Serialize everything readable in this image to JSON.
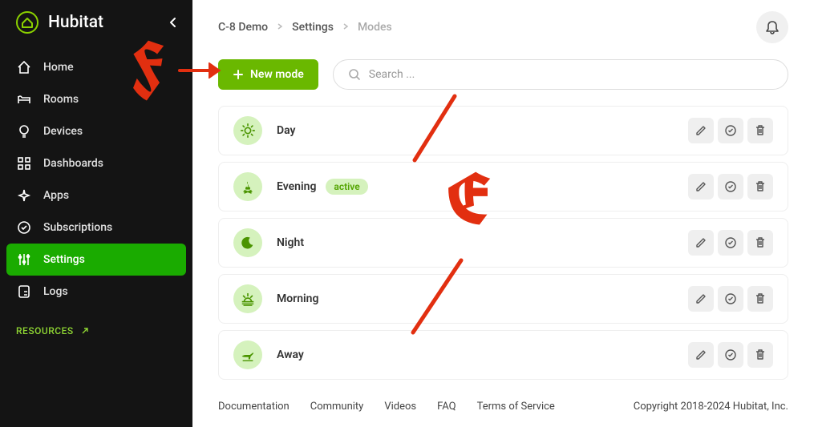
{
  "brand": "Hubitat",
  "sidebar": {
    "items": [
      {
        "label": "Home"
      },
      {
        "label": "Rooms"
      },
      {
        "label": "Devices"
      },
      {
        "label": "Dashboards"
      },
      {
        "label": "Apps"
      },
      {
        "label": "Subscriptions"
      },
      {
        "label": "Settings"
      },
      {
        "label": "Logs"
      }
    ],
    "resources_label": "RESOURCES"
  },
  "breadcrumb": {
    "root": "C-8 Demo",
    "parent": "Settings",
    "current": "Modes"
  },
  "toolbar": {
    "new_mode_label": "New mode",
    "search_placeholder": "Search ..."
  },
  "modes": [
    {
      "name": "Day",
      "active": false,
      "icon": "sun"
    },
    {
      "name": "Evening",
      "active": true,
      "icon": "campfire"
    },
    {
      "name": "Night",
      "active": false,
      "icon": "moon"
    },
    {
      "name": "Morning",
      "active": false,
      "icon": "sunrise"
    },
    {
      "name": "Away",
      "active": false,
      "icon": "plane"
    }
  ],
  "active_label": "active",
  "footer": {
    "links": [
      "Documentation",
      "Community",
      "Videos",
      "FAQ",
      "Terms of Service"
    ],
    "copyright": "Copyright 2018-2024 Hubitat, Inc."
  },
  "colors": {
    "accent": "#6ab800",
    "sidebar_bg": "#141414"
  }
}
